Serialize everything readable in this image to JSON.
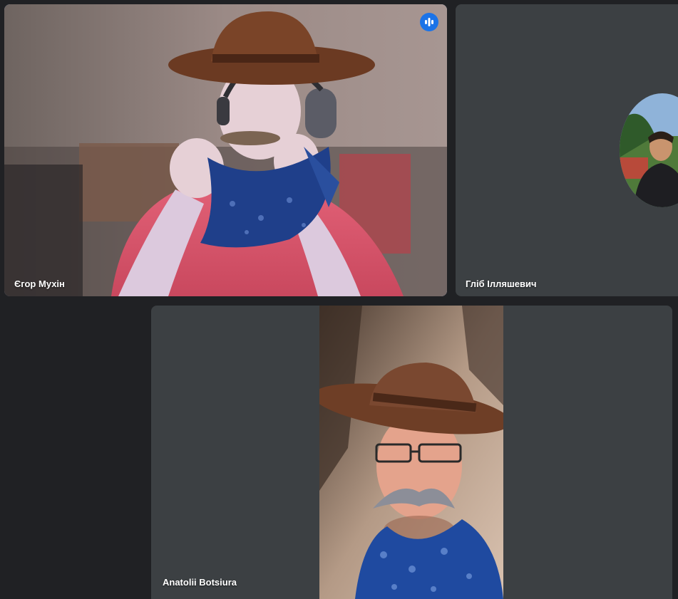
{
  "participants": [
    {
      "name": "Єгор Мухін",
      "speaking": true
    },
    {
      "name": "Гліб Ілляшевич",
      "speaking": false
    },
    {
      "name": "Anatolii Botsiura",
      "speaking": false
    }
  ],
  "colors": {
    "background": "#202124",
    "tile": "#3c4043",
    "active_border": "#8ab4f8",
    "speaking_badge": "#1a73e8"
  },
  "icons": {
    "speaking": "audio-level-icon"
  }
}
